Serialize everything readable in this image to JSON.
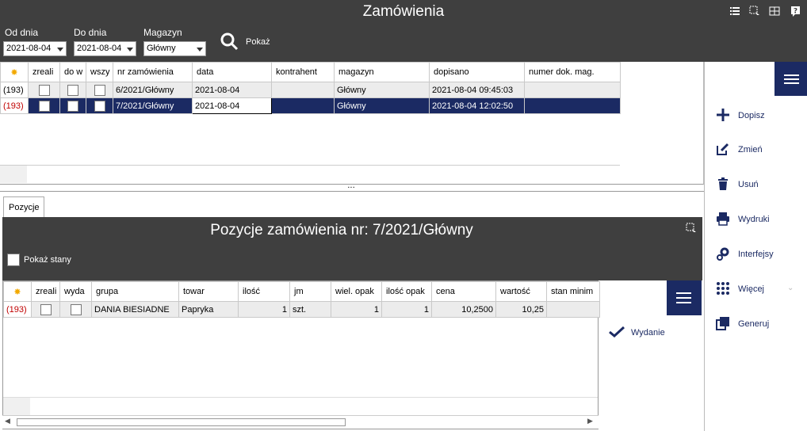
{
  "window": {
    "title": "Zamówienia"
  },
  "filters": {
    "od_dnia_label": "Od dnia",
    "od_dnia_value": "2021-08-04",
    "do_dnia_label": "Do dnia",
    "do_dnia_value": "2021-08-04",
    "magazyn_label": "Magazyn",
    "magazyn_value": "Główny",
    "pokaz_label": "Pokaż"
  },
  "orders": {
    "columns": [
      "zreali",
      "do w",
      "wszy",
      "nr zamówienia",
      "data",
      "kontrahent",
      "magazyn",
      "dopisano",
      "numer dok. mag."
    ],
    "rows": [
      {
        "id": "(193)",
        "nr": "6/2021/Główny",
        "data": "2021-08-04",
        "kontrahent": "",
        "magazyn": "Główny",
        "dopisano": "2021-08-04 09:45:03",
        "numer": ""
      },
      {
        "id": "(193)",
        "nr": "7/2021/Główny",
        "data": "2021-08-04",
        "kontrahent": "",
        "magazyn": "Główny",
        "dopisano": "2021-08-04 12:02:50",
        "numer": ""
      }
    ]
  },
  "divider": "...",
  "tabs": {
    "pozycje": "Pozycje"
  },
  "positions": {
    "title": "Pozycje zamówienia nr: 7/2021/Główny",
    "pokaz_stany": "Pokaż stany",
    "columns": [
      "zreali",
      "wyda",
      "grupa",
      "towar",
      "ilość",
      "jm",
      "wiel. opak",
      "ilość opak",
      "cena",
      "wartość",
      "stan minim"
    ],
    "rows": [
      {
        "id": "(193)",
        "grupa": "DANIA BIESIADNE",
        "towar": "Papryka",
        "ilosc": "1",
        "jm": "szt.",
        "wiel_opak": "1",
        "ilosc_opak": "1",
        "cena": "10,2500",
        "wartosc": "10,25",
        "stan": ""
      }
    ],
    "wydanie": "Wydanie"
  },
  "right_menu": {
    "dopisz": "Dopisz",
    "zmien": "Zmień",
    "usun": "Usuń",
    "wydruki": "Wydruki",
    "interfejsy": "Interfejsy",
    "wiecej": "Więcej",
    "generuj": "Generuj"
  },
  "colors": {
    "header_bg": "#3f3f3f",
    "accent": "#1b2a63",
    "row_red": "#c00000"
  }
}
